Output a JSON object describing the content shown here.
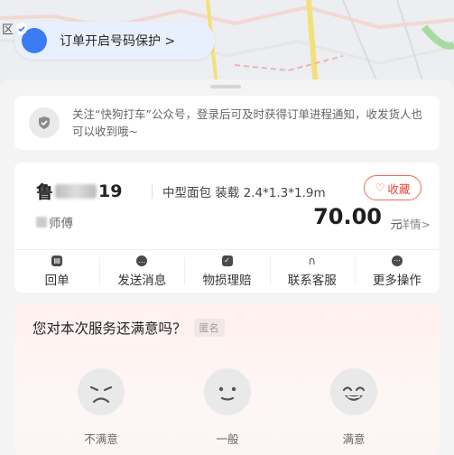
{
  "map": {
    "district_label": "区",
    "privacy_text": "订单开启号码保护 >"
  },
  "notice": {
    "text": "关注“快狗打车”公众号，登录后可及时获得订单进程通知，收发货人也可以收到哦~"
  },
  "order": {
    "plate_prefix": "鲁",
    "plate_suffix": "19",
    "vehicle_info": "中型面包 装载 2.4*1.3*1.9m",
    "collect_label": "收藏",
    "driver_name": "师傅",
    "price": "70.00",
    "price_unit": "元",
    "detail_label": "详情>"
  },
  "actions": [
    {
      "label": "回单",
      "icon": "receipt-icon"
    },
    {
      "label": "发送消息",
      "icon": "message-icon"
    },
    {
      "label": "物损理赔",
      "icon": "shield-icon"
    },
    {
      "label": "联系客服",
      "icon": "headset-icon"
    },
    {
      "label": "更多操作",
      "icon": "more-icon"
    }
  ],
  "survey": {
    "question": "您对本次服务还满意吗？",
    "anonymous_tag": "匿名",
    "options": [
      {
        "label": "不满意",
        "icon": "angry-face-icon"
      },
      {
        "label": "一般",
        "icon": "neutral-face-icon"
      },
      {
        "label": "满意",
        "icon": "happy-face-icon"
      }
    ]
  },
  "colors": {
    "accent_blue": "#3b7cf4",
    "collect_red": "#e5473a"
  }
}
